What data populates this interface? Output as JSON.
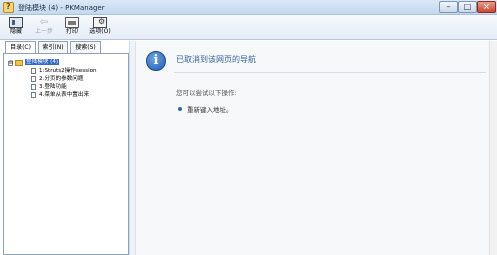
{
  "window": {
    "title": "登陆模块 (4) - PKManager",
    "controls": {
      "minimize": "–",
      "maximize": "□",
      "close": "×"
    }
  },
  "toolbar": {
    "buttons": [
      {
        "label": "隐藏",
        "icon": "hide-pane-icon"
      },
      {
        "label": "上一步",
        "icon": "back-arrow-icon"
      },
      {
        "label": "打印",
        "icon": "printer-icon"
      },
      {
        "label": "选项(O)",
        "icon": "options-icon"
      }
    ]
  },
  "navigation": {
    "tabs": [
      "目录(C)",
      "索引(N)",
      "搜索(S)"
    ],
    "tree": {
      "toggle": "⊟",
      "root": "登陆模块 (4)",
      "items": [
        "1:Struts2操作session",
        "2.分页的参数问题",
        "3.登陆功能",
        "4.菜单从表中置出来"
      ]
    }
  },
  "content": {
    "icon": "info-icon",
    "icon_glyph": "i",
    "title": "已取消到该网页的导航",
    "suggestion_intro": "您可以尝试以下操作:",
    "suggestions": [
      "重新键入地址。"
    ]
  },
  "colors": {
    "title_blue": "#355f9c",
    "tree_selected": "#316ac5",
    "info_blue": "#1f5ab3"
  }
}
